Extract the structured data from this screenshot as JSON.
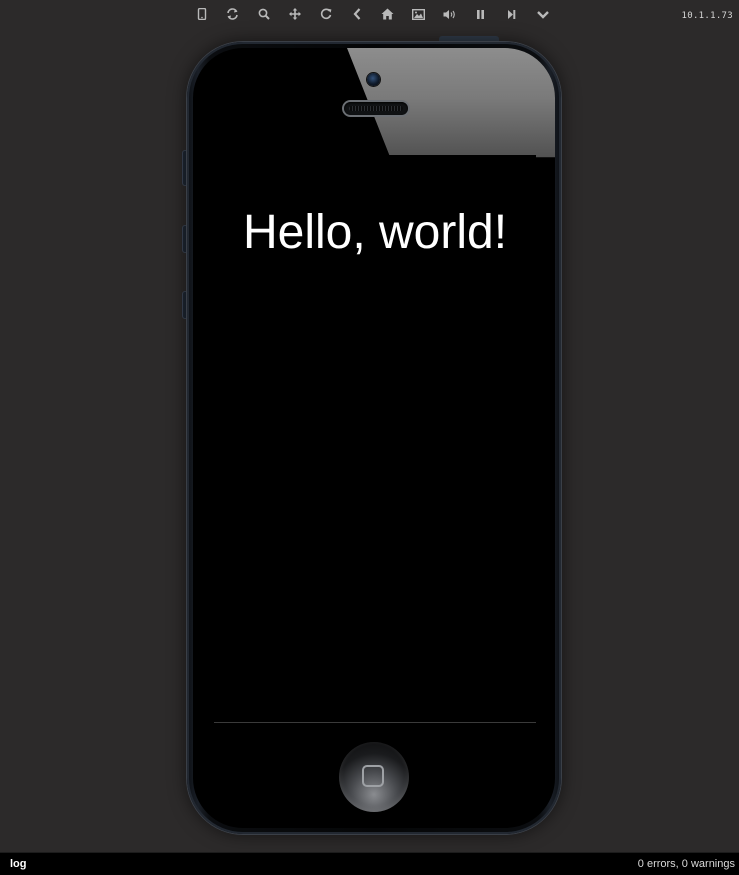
{
  "toolbar": {
    "icons": [
      {
        "name": "device-icon"
      },
      {
        "name": "rotate-icon"
      },
      {
        "name": "zoom-icon"
      },
      {
        "name": "move-icon"
      },
      {
        "name": "reload-icon"
      },
      {
        "name": "back-icon"
      },
      {
        "name": "home-icon"
      },
      {
        "name": "screenshot-icon"
      },
      {
        "name": "volume-icon"
      },
      {
        "name": "pause-icon"
      },
      {
        "name": "step-icon"
      },
      {
        "name": "chevron-down-icon"
      }
    ],
    "ip_address": "10.1.1.73"
  },
  "screen": {
    "message": "Hello, world!"
  },
  "statusbar": {
    "log_label": "log",
    "summary": "0 errors, 0 warnings"
  },
  "colors": {
    "background": "#2c2a2a",
    "icon": "#b9b9b9",
    "screen": "#000000",
    "text": "#ffffff"
  }
}
